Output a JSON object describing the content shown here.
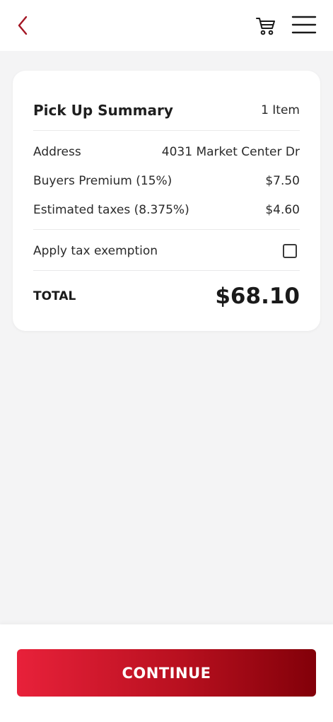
{
  "header": {
    "back_icon": "chevron-left-icon",
    "cart_icon": "cart-icon",
    "menu_icon": "hamburger-menu-icon",
    "accent_color": "#a31523"
  },
  "summary": {
    "title": "Pick Up Summary",
    "item_count": "1 Item",
    "rows": [
      {
        "label": "Address",
        "value": "4031 Market Center Dr"
      },
      {
        "label": "Buyers Premium (15%)",
        "value": "$7.50"
      },
      {
        "label": "Estimated taxes (8.375%)",
        "value": "$4.60"
      }
    ],
    "tax_exemption": {
      "label": "Apply tax exemption",
      "checked": false
    },
    "total_label": "TOTAL",
    "total_value": "$68.10"
  },
  "footer": {
    "continue_label": "CONTINUE",
    "button_gradient_start": "#e8213a",
    "button_gradient_end": "#820009"
  }
}
